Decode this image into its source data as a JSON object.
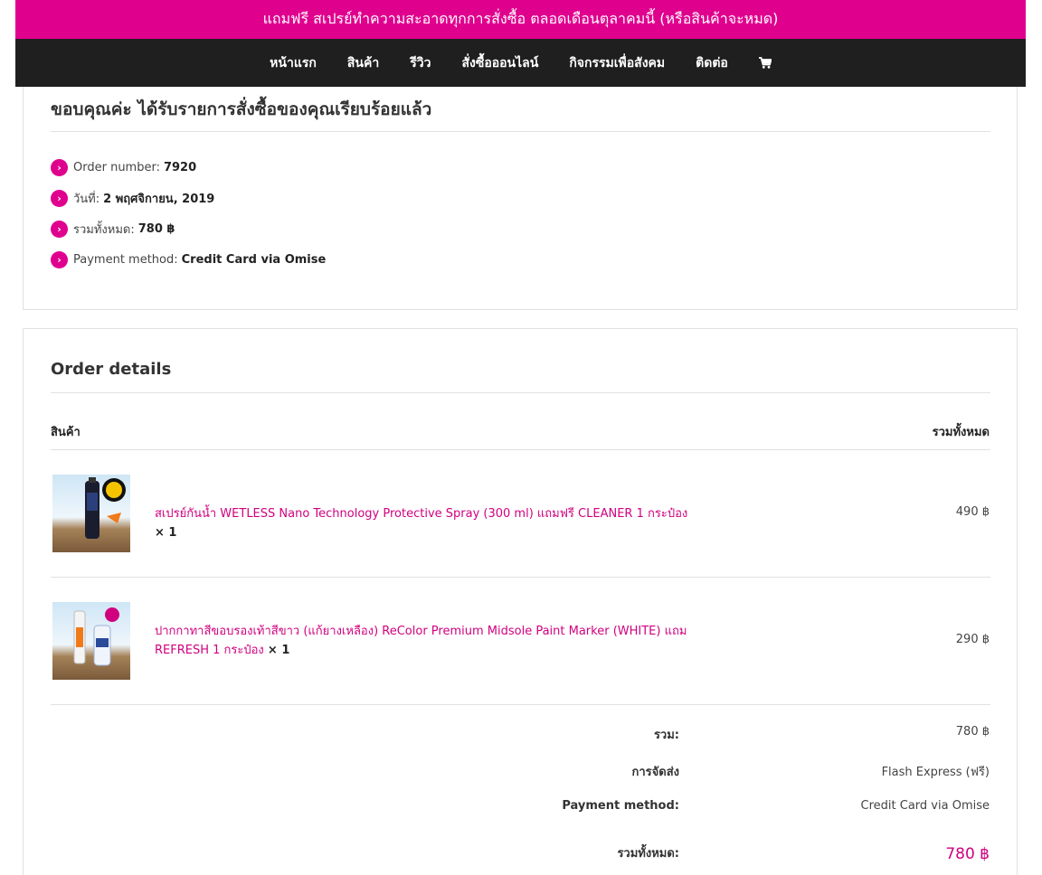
{
  "promo": {
    "text": "แถมฟรี สเปรย์ทำความสะอาดทุกการสั่งซื้อ ตลอดเดือนตุลาคมนี้ (หรือสินค้าจะหมด)"
  },
  "nav": {
    "items": [
      "หน้าแรก",
      "สินค้า",
      "รีวิว",
      "สั่งซื้อออนไลน์",
      "กิจกรรมเพื่อสังคม",
      "ติดต่อ"
    ],
    "cart_icon": "cart-icon"
  },
  "thanks": {
    "title": "ขอบคุณค่ะ ได้รับรายการสั่งซื้อของคุณเรียบร้อยแล้ว"
  },
  "overview": {
    "order_number": {
      "label": "Order number:",
      "value": "7920"
    },
    "date": {
      "label": "วันที่:",
      "value": "2 พฤศจิกายน, 2019"
    },
    "total": {
      "label": "รวมทั้งหมด:",
      "value": "780 ฿"
    },
    "payment": {
      "label": "Payment method:",
      "value": "Credit Card via Omise"
    }
  },
  "details": {
    "title": "Order details",
    "header_product": "สินค้า",
    "header_total": "รวมทั้งหมด",
    "items": [
      {
        "name": "สเปรย์กันน้ำ WETLESS Nano Technology Protective Spray (300 ml) แถมฟรี CLEANER 1 กระป๋อง",
        "qty": "× 1",
        "total": "490 ฿"
      },
      {
        "name": "ปากกาทาสีขอบรองเท้าสีขาว (แก้ยางเหลือง) ReColor Premium Midsole Paint Marker (WHITE) แถม REFRESH 1 กระป๋อง",
        "qty": "× 1",
        "total": "290 ฿"
      }
    ],
    "subtotal": {
      "label": "รวม:",
      "value": "780 ฿"
    },
    "shipping": {
      "label": "การจัดส่ง",
      "value": "Flash Express (ฟรี)"
    },
    "payment": {
      "label": "Payment method:",
      "value": "Credit Card via Omise"
    },
    "grand_total": {
      "label": "รวมทั้งหมด:",
      "value": "780 ฿"
    }
  },
  "colors": {
    "accent": "#e0008e",
    "nav_bg": "#1f1f1f",
    "link": "#d1007f"
  }
}
